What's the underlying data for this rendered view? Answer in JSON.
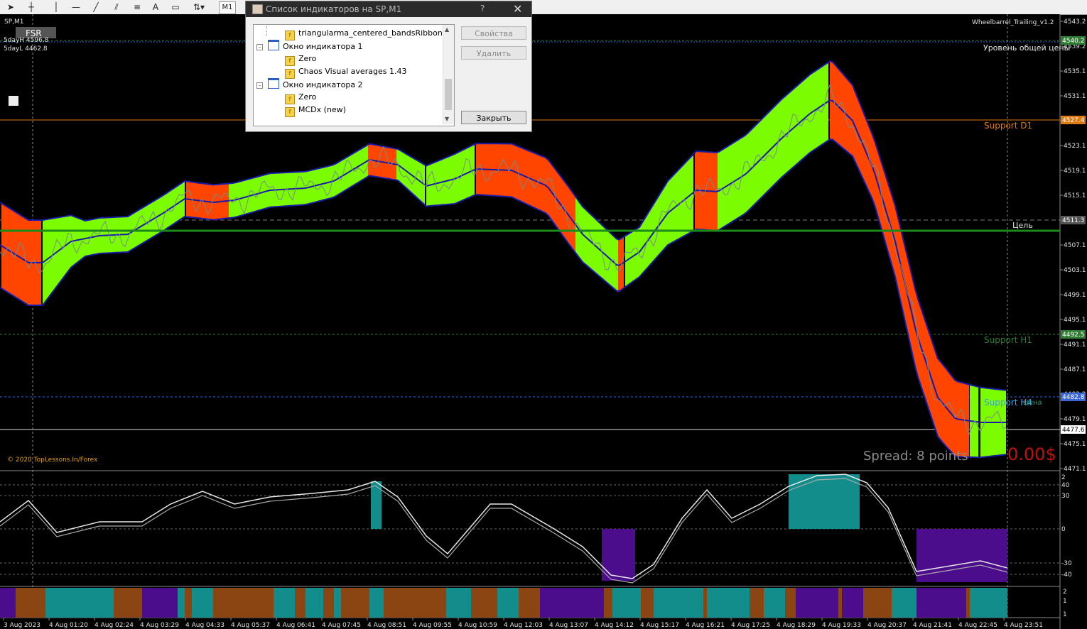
{
  "toolbar": {
    "timeframe": "M1"
  },
  "chart": {
    "symbol": "SP,M1",
    "indicator_name": "Wheelbarrel_Trailing_v1.2",
    "badge": "FSR",
    "day_high": "5dayH 4596.8",
    "day_low": "5dayL 4462.8",
    "copyright": "© 2020 TopLessons.In/Forex",
    "spread": "Spread: 8 points",
    "profit": "0.00$",
    "levels": {
      "general": "Уровень общей цены",
      "support_d1": "Support D1",
      "target": "Цель",
      "support_h1": "Support H1",
      "support_h4": "Support H4",
      "price_label": "Цена"
    },
    "price_ticks": [
      "4543.2",
      "4539.2",
      "4535.1",
      "4531.1",
      "4527.1",
      "4523.1",
      "4519.1",
      "4515.1",
      "4511.1",
      "4507.1",
      "4503.1",
      "4499.1",
      "4495.1",
      "4491.1",
      "4487.1",
      "4483.2",
      "4479.1",
      "4475.1",
      "4471.1"
    ],
    "price_boxes": [
      {
        "text": "4540.2",
        "color": "#2e7d32"
      },
      {
        "text": "4527.4",
        "color": "#e07a10"
      },
      {
        "text": "4511.3",
        "color": "#555555"
      },
      {
        "text": "4492.5",
        "color": "#2e7d32"
      },
      {
        "text": "4482.8",
        "color": "#3b66d6"
      },
      {
        "text": "4477.6",
        "color": "#ffffff"
      }
    ],
    "osc_ticks": [
      "2",
      "40",
      "30",
      "0",
      "-30",
      "-40"
    ],
    "sub_ticks": [
      "2",
      "1",
      "1"
    ],
    "time_ticks": [
      "3 Aug 2023",
      "4 Aug 01:20",
      "4 Aug 02:24",
      "4 Aug 03:29",
      "4 Aug 04:33",
      "4 Aug 05:37",
      "4 Aug 06:41",
      "4 Aug 07:45",
      "4 Aug 08:51",
      "4 Aug 09:55",
      "4 Aug 10:59",
      "4 Aug 12:03",
      "4 Aug 13:07",
      "4 Aug 14:12",
      "4 Aug 15:17",
      "4 Aug 16:21",
      "4 Aug 17:25",
      "4 Aug 18:29",
      "4 Aug 19:33",
      "4 Aug 20:37",
      "4 Aug 21:41",
      "4 Aug 22:45",
      "4 Aug 23:51"
    ],
    "colors": {
      "bull": "#7cfc00",
      "bear": "#ff4500",
      "ma": "#1a1aa8",
      "target": "#1a8a1a",
      "teal": "#138c8c",
      "purple": "#4b0d8c",
      "brown": "#8b4513"
    }
  },
  "dialog": {
    "title": "Список индикаторов на SP,M1",
    "help": "?",
    "close_x": "✕",
    "tree": [
      {
        "label": "triangularma_centered_bandsRibbonV3",
        "type": "ind",
        "level": 2
      },
      {
        "label": "Окно индикатора 1",
        "type": "win",
        "level": 1
      },
      {
        "label": "Zero",
        "type": "ind",
        "level": 2
      },
      {
        "label": "Chaos Visual averages 1.43",
        "type": "ind",
        "level": 2
      },
      {
        "label": "Окно индикатора 2",
        "type": "win",
        "level": 1
      },
      {
        "label": "Zero",
        "type": "ind",
        "level": 2
      },
      {
        "label": "MCDx (new)",
        "type": "ind",
        "level": 2
      }
    ],
    "buttons": {
      "properties": "Свойства",
      "delete": "Удалить",
      "close": "Закрыть"
    }
  }
}
